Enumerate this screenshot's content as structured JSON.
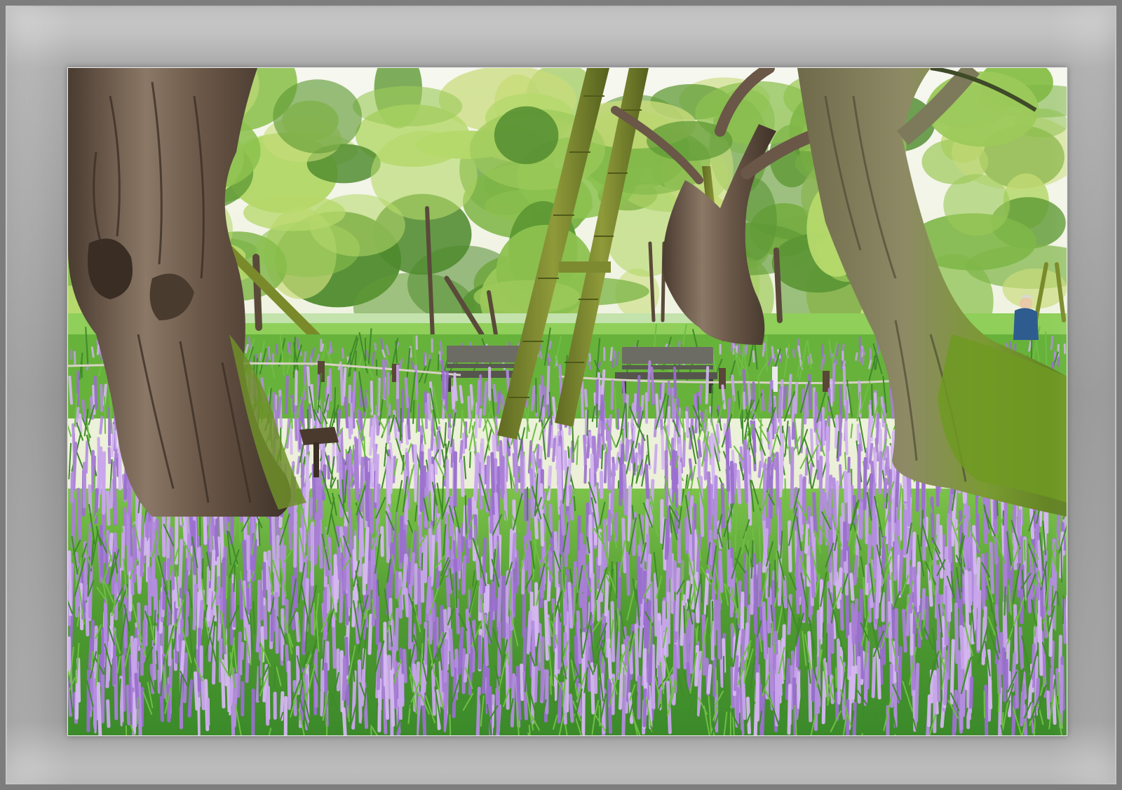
{
  "scene": {
    "subject": "lilyturf-flower-field-park",
    "colors": {
      "frame_gray": "#8f8f8f",
      "sky": "#f4f5ec",
      "foliage_light": "#b9d86a",
      "foliage_dark": "#3f7a2a",
      "grass": "#5fae3a",
      "flower_purple": "#a97fd6",
      "flower_light": "#c9a6ec",
      "bark": "#6e5a48",
      "moss": "#7a9b2e",
      "bench": "#6b6a62"
    }
  }
}
